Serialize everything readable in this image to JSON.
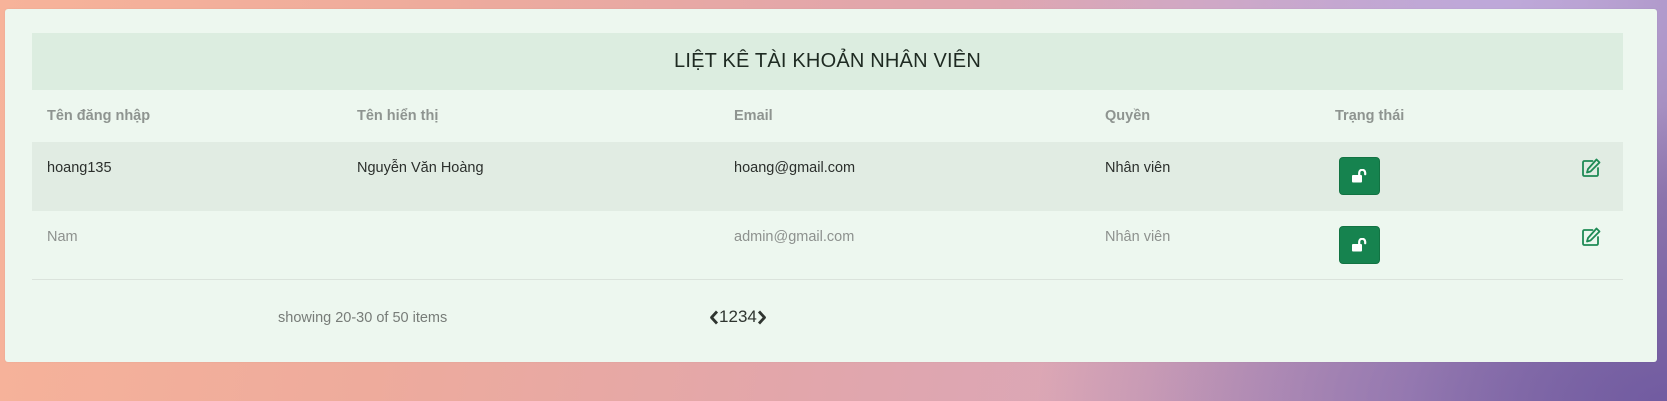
{
  "table": {
    "title": "LIỆT KÊ TÀI KHOẢN NHÂN VIÊN",
    "headers": {
      "username": "Tên đăng nhập",
      "display_name": "Tên hiển thị",
      "email": "Email",
      "role": "Quyền",
      "status": "Trạng thái"
    },
    "rows": [
      {
        "username": "hoang135",
        "display_name": "Nguyễn Văn Hoàng",
        "email": "hoang@gmail.com",
        "role": "Nhân viên",
        "status_icon": "unlock-icon",
        "edit_icon": "edit-icon"
      },
      {
        "username": "Nam",
        "display_name": "",
        "email": "admin@gmail.com",
        "role": "Nhân viên",
        "status_icon": "unlock-icon",
        "edit_icon": "edit-icon"
      }
    ]
  },
  "pagination": {
    "summary": "showing 20-30 of 50 items",
    "pages": [
      "1",
      "2",
      "3",
      "4"
    ],
    "prev_icon": "chevron-left-icon",
    "next_icon": "chevron-right-icon"
  },
  "colors": {
    "accent_green": "#16834f",
    "panel_background": "#edf7ef",
    "title_background": "#dcede0",
    "highlight_row": "#e1ece3"
  }
}
